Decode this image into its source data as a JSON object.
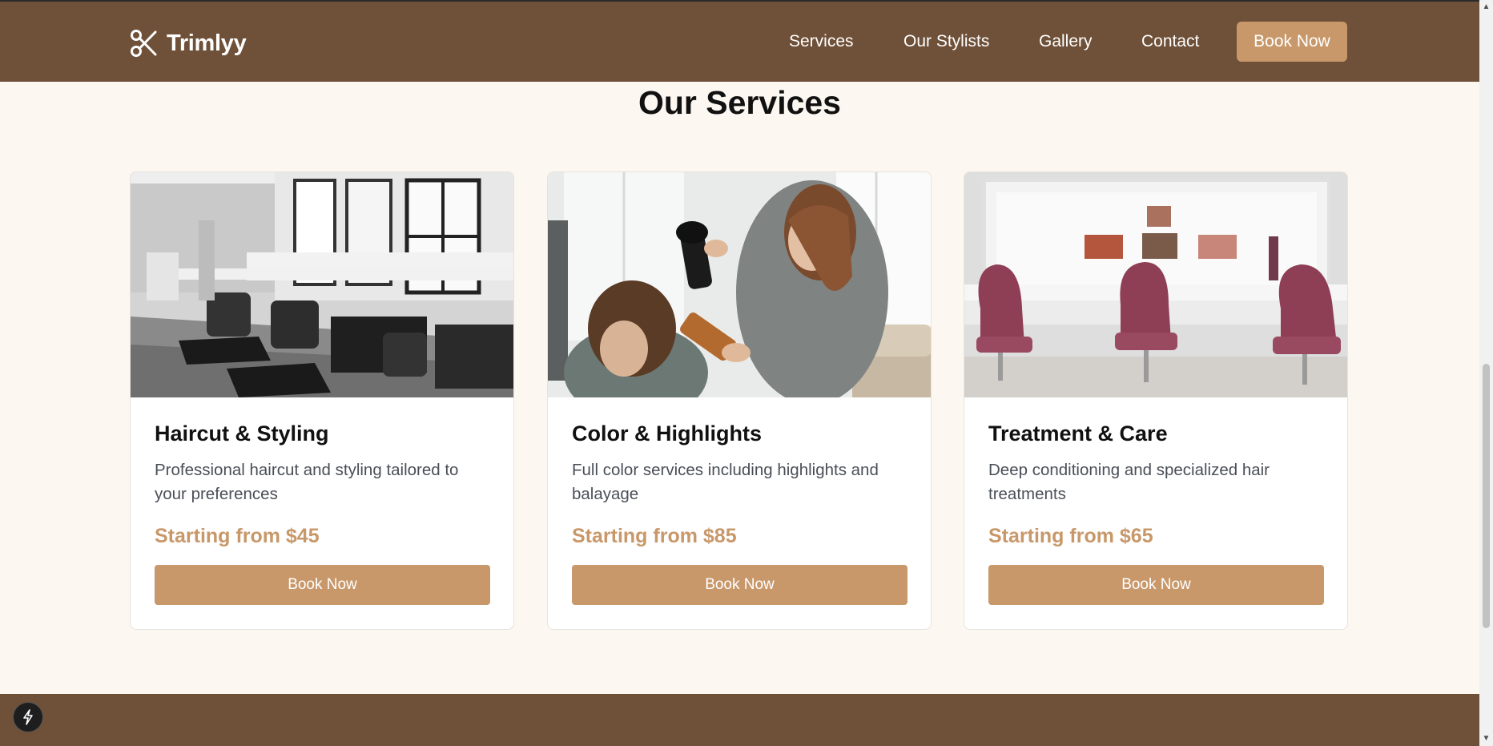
{
  "brand": {
    "name": "Trimlyy",
    "icon": "scissors-icon"
  },
  "nav": {
    "links": [
      "Services",
      "Our Stylists",
      "Gallery",
      "Contact"
    ],
    "cta": "Book Now"
  },
  "services": {
    "title": "Our Services",
    "cards": [
      {
        "image": "salon-interior-bw-photo",
        "title": "Haircut & Styling",
        "description": "Professional haircut and styling tailored to your preferences",
        "price": "Starting from $45",
        "button": "Book Now"
      },
      {
        "image": "stylist-blowdrying-photo",
        "title": "Color & Highlights",
        "description": "Full color services including highlights and balayage",
        "price": "Starting from $85",
        "button": "Book Now"
      },
      {
        "image": "salon-pink-chairs-photo",
        "title": "Treatment & Care",
        "description": "Deep conditioning and specialized hair treatments",
        "price": "Starting from $65",
        "button": "Book Now"
      }
    ]
  },
  "colors": {
    "nav_bg": "#6f5038",
    "accent": "#c8986a",
    "page_bg": "#fcf7f1"
  },
  "widget": {
    "icon": "lightning-bolt-icon"
  }
}
